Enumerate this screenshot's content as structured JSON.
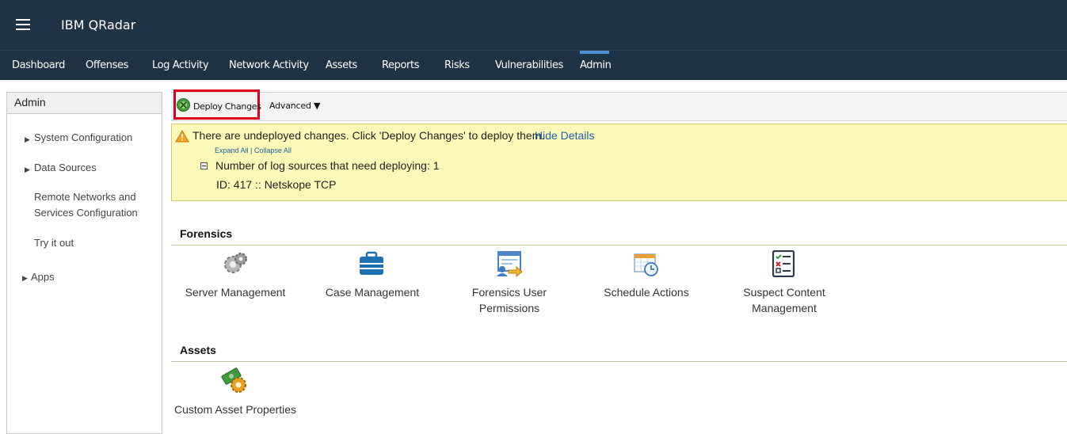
{
  "app": {
    "title": "IBM QRadar"
  },
  "nav": {
    "tabs": [
      "Dashboard",
      "Offenses",
      "Log Activity",
      "Network Activity",
      "Assets",
      "Reports",
      "Risks",
      "Vulnerabilities",
      "Admin"
    ],
    "active": "Admin"
  },
  "sidebar": {
    "title": "Admin",
    "items": [
      "System Configuration",
      "Data Sources",
      "Remote Networks and",
      "Services Configuration",
      "Try it out",
      "Apps"
    ]
  },
  "toolbar": {
    "deploy_label": "Deploy Changes",
    "advanced_label": "Advanced ▼"
  },
  "notice": {
    "message": "There are undeployed changes. Click 'Deploy Changes' to deploy them.",
    "hide_details": "Hide Details",
    "expand_all": "Expand All",
    "separator": " | ",
    "collapse_all": "Collapse All",
    "count_text": "Number of log sources that need deploying: 1",
    "id_text": "ID: 417 :: Netskope TCP"
  },
  "forensics": {
    "title": "Forensics",
    "tools": [
      {
        "line1": "Server Management",
        "line2": "",
        "icon": "gears-icon"
      },
      {
        "line1": "Case Management",
        "line2": "",
        "icon": "briefcase-icon"
      },
      {
        "line1": "Forensics User",
        "line2": "Permissions",
        "icon": "user-permissions-icon"
      },
      {
        "line1": "Schedule Actions",
        "line2": "",
        "icon": "schedule-icon"
      },
      {
        "line1": "Suspect Content",
        "line2": "Management",
        "icon": "checklist-icon"
      }
    ]
  },
  "assets": {
    "title": "Assets",
    "tools": [
      {
        "line1": "Custom Asset Properties",
        "icon": "asset-properties-icon"
      }
    ]
  },
  "colors": {
    "header_bg": "#1e3345",
    "active_tab_accent": "#4d90d6",
    "notice_bg": "#fbf8b8",
    "highlight_border": "#e0001b",
    "link": "#1f5fa8"
  }
}
